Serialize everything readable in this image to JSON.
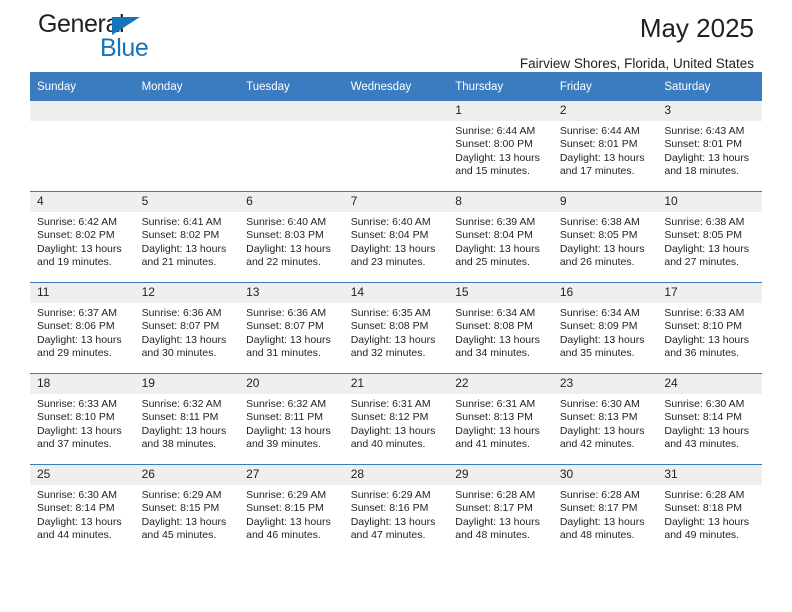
{
  "brand": {
    "name_top": "General",
    "name_bottom": "Blue",
    "flag_color": "#1574bb"
  },
  "header": {
    "month_title": "May 2025",
    "location": "Fairview Shores, Florida, United States"
  },
  "theme": {
    "header_blue": "#3b7cc0",
    "daynum_band": "#efefef",
    "text": "#231f20"
  },
  "calendar": {
    "weekday_headers": [
      "Sunday",
      "Monday",
      "Tuesday",
      "Wednesday",
      "Thursday",
      "Friday",
      "Saturday"
    ],
    "labels": {
      "sunrise": "Sunrise:",
      "sunset": "Sunset:",
      "daylight": "Daylight:"
    },
    "weeks": [
      [
        {
          "day": ""
        },
        {
          "day": ""
        },
        {
          "day": ""
        },
        {
          "day": ""
        },
        {
          "day": "1",
          "sunrise": "Sunrise: 6:44 AM",
          "sunset": "Sunset: 8:00 PM",
          "daylight_1": "Daylight: 13 hours",
          "daylight_2": "and 15 minutes."
        },
        {
          "day": "2",
          "sunrise": "Sunrise: 6:44 AM",
          "sunset": "Sunset: 8:01 PM",
          "daylight_1": "Daylight: 13 hours",
          "daylight_2": "and 17 minutes."
        },
        {
          "day": "3",
          "sunrise": "Sunrise: 6:43 AM",
          "sunset": "Sunset: 8:01 PM",
          "daylight_1": "Daylight: 13 hours",
          "daylight_2": "and 18 minutes."
        }
      ],
      [
        {
          "day": "4",
          "sunrise": "Sunrise: 6:42 AM",
          "sunset": "Sunset: 8:02 PM",
          "daylight_1": "Daylight: 13 hours",
          "daylight_2": "and 19 minutes."
        },
        {
          "day": "5",
          "sunrise": "Sunrise: 6:41 AM",
          "sunset": "Sunset: 8:02 PM",
          "daylight_1": "Daylight: 13 hours",
          "daylight_2": "and 21 minutes."
        },
        {
          "day": "6",
          "sunrise": "Sunrise: 6:40 AM",
          "sunset": "Sunset: 8:03 PM",
          "daylight_1": "Daylight: 13 hours",
          "daylight_2": "and 22 minutes."
        },
        {
          "day": "7",
          "sunrise": "Sunrise: 6:40 AM",
          "sunset": "Sunset: 8:04 PM",
          "daylight_1": "Daylight: 13 hours",
          "daylight_2": "and 23 minutes."
        },
        {
          "day": "8",
          "sunrise": "Sunrise: 6:39 AM",
          "sunset": "Sunset: 8:04 PM",
          "daylight_1": "Daylight: 13 hours",
          "daylight_2": "and 25 minutes."
        },
        {
          "day": "9",
          "sunrise": "Sunrise: 6:38 AM",
          "sunset": "Sunset: 8:05 PM",
          "daylight_1": "Daylight: 13 hours",
          "daylight_2": "and 26 minutes."
        },
        {
          "day": "10",
          "sunrise": "Sunrise: 6:38 AM",
          "sunset": "Sunset: 8:05 PM",
          "daylight_1": "Daylight: 13 hours",
          "daylight_2": "and 27 minutes."
        }
      ],
      [
        {
          "day": "11",
          "sunrise": "Sunrise: 6:37 AM",
          "sunset": "Sunset: 8:06 PM",
          "daylight_1": "Daylight: 13 hours",
          "daylight_2": "and 29 minutes."
        },
        {
          "day": "12",
          "sunrise": "Sunrise: 6:36 AM",
          "sunset": "Sunset: 8:07 PM",
          "daylight_1": "Daylight: 13 hours",
          "daylight_2": "and 30 minutes."
        },
        {
          "day": "13",
          "sunrise": "Sunrise: 6:36 AM",
          "sunset": "Sunset: 8:07 PM",
          "daylight_1": "Daylight: 13 hours",
          "daylight_2": "and 31 minutes."
        },
        {
          "day": "14",
          "sunrise": "Sunrise: 6:35 AM",
          "sunset": "Sunset: 8:08 PM",
          "daylight_1": "Daylight: 13 hours",
          "daylight_2": "and 32 minutes."
        },
        {
          "day": "15",
          "sunrise": "Sunrise: 6:34 AM",
          "sunset": "Sunset: 8:08 PM",
          "daylight_1": "Daylight: 13 hours",
          "daylight_2": "and 34 minutes."
        },
        {
          "day": "16",
          "sunrise": "Sunrise: 6:34 AM",
          "sunset": "Sunset: 8:09 PM",
          "daylight_1": "Daylight: 13 hours",
          "daylight_2": "and 35 minutes."
        },
        {
          "day": "17",
          "sunrise": "Sunrise: 6:33 AM",
          "sunset": "Sunset: 8:10 PM",
          "daylight_1": "Daylight: 13 hours",
          "daylight_2": "and 36 minutes."
        }
      ],
      [
        {
          "day": "18",
          "sunrise": "Sunrise: 6:33 AM",
          "sunset": "Sunset: 8:10 PM",
          "daylight_1": "Daylight: 13 hours",
          "daylight_2": "and 37 minutes."
        },
        {
          "day": "19",
          "sunrise": "Sunrise: 6:32 AM",
          "sunset": "Sunset: 8:11 PM",
          "daylight_1": "Daylight: 13 hours",
          "daylight_2": "and 38 minutes."
        },
        {
          "day": "20",
          "sunrise": "Sunrise: 6:32 AM",
          "sunset": "Sunset: 8:11 PM",
          "daylight_1": "Daylight: 13 hours",
          "daylight_2": "and 39 minutes."
        },
        {
          "day": "21",
          "sunrise": "Sunrise: 6:31 AM",
          "sunset": "Sunset: 8:12 PM",
          "daylight_1": "Daylight: 13 hours",
          "daylight_2": "and 40 minutes."
        },
        {
          "day": "22",
          "sunrise": "Sunrise: 6:31 AM",
          "sunset": "Sunset: 8:13 PM",
          "daylight_1": "Daylight: 13 hours",
          "daylight_2": "and 41 minutes."
        },
        {
          "day": "23",
          "sunrise": "Sunrise: 6:30 AM",
          "sunset": "Sunset: 8:13 PM",
          "daylight_1": "Daylight: 13 hours",
          "daylight_2": "and 42 minutes."
        },
        {
          "day": "24",
          "sunrise": "Sunrise: 6:30 AM",
          "sunset": "Sunset: 8:14 PM",
          "daylight_1": "Daylight: 13 hours",
          "daylight_2": "and 43 minutes."
        }
      ],
      [
        {
          "day": "25",
          "sunrise": "Sunrise: 6:30 AM",
          "sunset": "Sunset: 8:14 PM",
          "daylight_1": "Daylight: 13 hours",
          "daylight_2": "and 44 minutes."
        },
        {
          "day": "26",
          "sunrise": "Sunrise: 6:29 AM",
          "sunset": "Sunset: 8:15 PM",
          "daylight_1": "Daylight: 13 hours",
          "daylight_2": "and 45 minutes."
        },
        {
          "day": "27",
          "sunrise": "Sunrise: 6:29 AM",
          "sunset": "Sunset: 8:15 PM",
          "daylight_1": "Daylight: 13 hours",
          "daylight_2": "and 46 minutes."
        },
        {
          "day": "28",
          "sunrise": "Sunrise: 6:29 AM",
          "sunset": "Sunset: 8:16 PM",
          "daylight_1": "Daylight: 13 hours",
          "daylight_2": "and 47 minutes."
        },
        {
          "day": "29",
          "sunrise": "Sunrise: 6:28 AM",
          "sunset": "Sunset: 8:17 PM",
          "daylight_1": "Daylight: 13 hours",
          "daylight_2": "and 48 minutes."
        },
        {
          "day": "30",
          "sunrise": "Sunrise: 6:28 AM",
          "sunset": "Sunset: 8:17 PM",
          "daylight_1": "Daylight: 13 hours",
          "daylight_2": "and 48 minutes."
        },
        {
          "day": "31",
          "sunrise": "Sunrise: 6:28 AM",
          "sunset": "Sunset: 8:18 PM",
          "daylight_1": "Daylight: 13 hours",
          "daylight_2": "and 49 minutes."
        }
      ]
    ]
  }
}
